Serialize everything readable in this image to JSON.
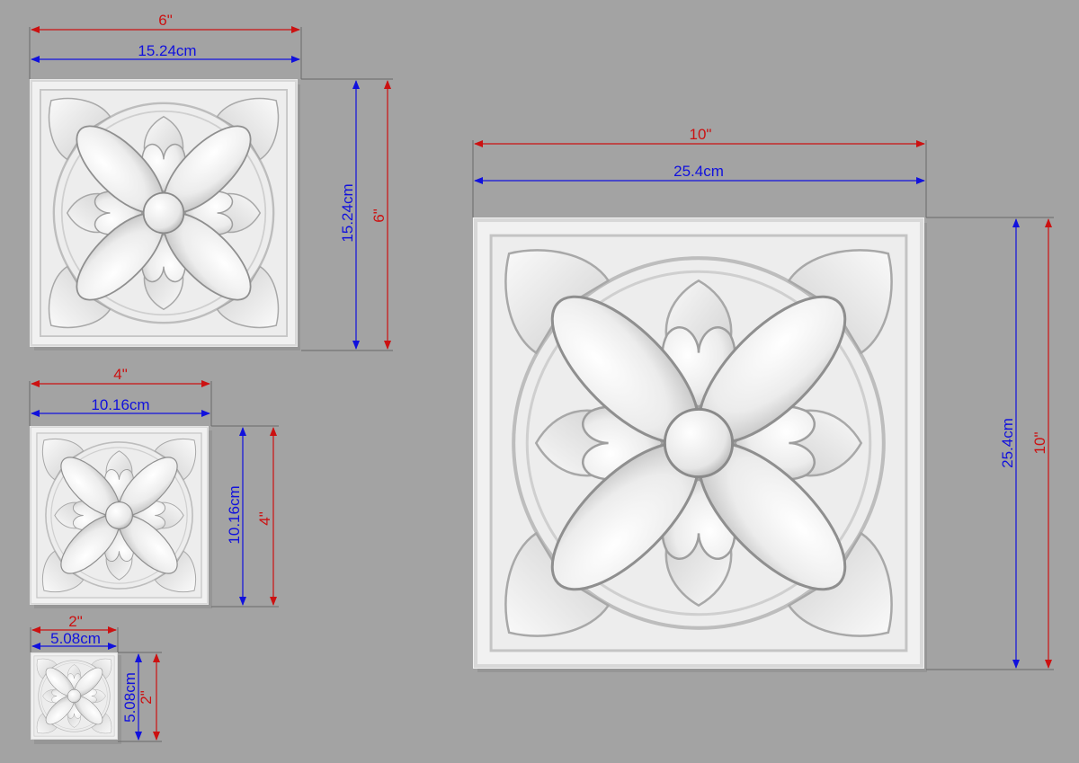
{
  "colors": {
    "background": "#a3a3a3",
    "inch_dimension": "#cc1111",
    "cm_dimension": "#1111dd",
    "tile_face": "#f0f0f0",
    "tile_shadow": "#9a9a9a"
  },
  "tiles": [
    {
      "id": "tile-6in",
      "width_inch": "6\"",
      "width_cm": "15.24cm",
      "height_cm": "15.24cm",
      "height_inch": "6\""
    },
    {
      "id": "tile-4in",
      "width_inch": "4\"",
      "width_cm": "10.16cm",
      "height_cm": "10.16cm",
      "height_inch": "4\""
    },
    {
      "id": "tile-2in",
      "width_inch": "2\"",
      "width_cm": "5.08cm",
      "height_cm": "5.08cm",
      "height_inch": "2\""
    },
    {
      "id": "tile-10in",
      "width_inch": "10\"",
      "width_cm": "25.4cm",
      "height_cm": "25.4cm",
      "height_inch": "10\""
    }
  ]
}
